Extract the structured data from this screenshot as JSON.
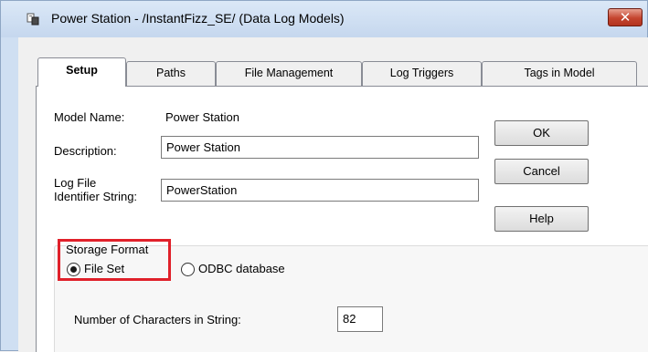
{
  "window": {
    "title": "Power Station - /InstantFizz_SE/ (Data Log Models)",
    "close_label": "✕"
  },
  "tabs": [
    {
      "label": "Setup",
      "active": true
    },
    {
      "label": "Paths",
      "active": false
    },
    {
      "label": "File Management",
      "active": false
    },
    {
      "label": "Log Triggers",
      "active": false
    },
    {
      "label": "Tags in Model",
      "active": false
    }
  ],
  "setup": {
    "model_name_label": "Model Name:",
    "model_name_value": "Power Station",
    "description_label": "Description:",
    "description_value": "Power Station",
    "identifier_label_line1": "Log File",
    "identifier_label_line2": "Identifier String:",
    "identifier_value": "PowerStation"
  },
  "buttons": {
    "ok": "OK",
    "cancel": "Cancel",
    "help": "Help"
  },
  "storage": {
    "group_label": "Storage Format",
    "options": [
      {
        "label": "File Set",
        "selected": true
      },
      {
        "label": "ODBC database",
        "selected": false
      }
    ],
    "num_chars_label": "Number of Characters in String:",
    "num_chars_value": "82"
  },
  "colors": {
    "highlight_box": "#e0202a",
    "close_button": "#c4442e"
  }
}
